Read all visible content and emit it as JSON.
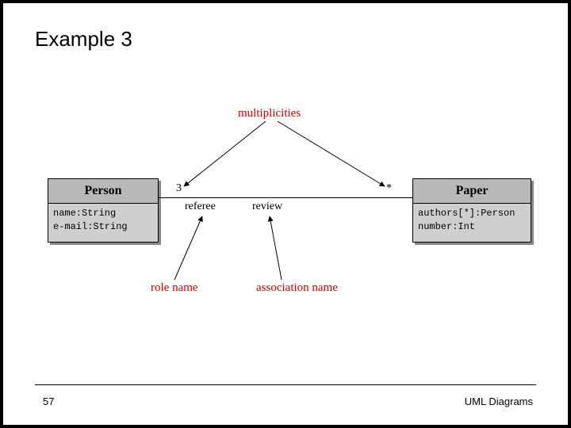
{
  "title": "Example 3",
  "uml": {
    "person": {
      "name": "Person",
      "attrs": [
        "name:String",
        "e-mail:String"
      ]
    },
    "paper": {
      "name": "Paper",
      "attrs": [
        "authors[*]:Person",
        "number:Int"
      ]
    },
    "association": {
      "mult_left": "3",
      "role_left": "referee",
      "name": "review",
      "mult_right": "*"
    }
  },
  "annotations": {
    "multiplicities": "multiplicities",
    "role_name": "role name",
    "association_name": "association name"
  },
  "footer": {
    "page": "57",
    "label": "UML Diagrams"
  }
}
